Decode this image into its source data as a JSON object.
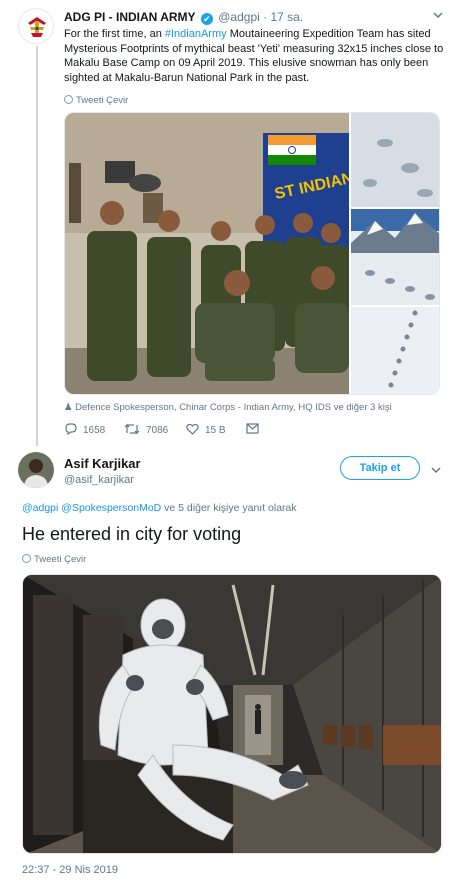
{
  "parent_tweet": {
    "author_name": "ADG PI - INDIAN ARMY",
    "verified_mark": "✔",
    "handle": "@adgpi",
    "separator": "·",
    "time": "17 sa.",
    "text_before": "For the first time, an ",
    "hashtag": "#IndianArmy",
    "text_after": " Moutaineering Expedition Team has sited Mysterious Footprints of mythical beast 'Yeti' measuring 32x15 inches close to Makalu Base Camp on 09 April 2019. This elusive snowman has only been sighted at Makalu-Barun National Park in the past.",
    "translate_label": "Tweeti Çevir",
    "tagged_people": "Defence Spokesperson, Chinar Corps - Indian Army, HQ IDS ve diğer 3 kişi",
    "reply_count": "1658",
    "retweet_count": "7086",
    "like_count": "15 B",
    "icons": [
      "army-emblem-icon",
      "verified-icon",
      "chevron-down-icon",
      "globe-icon",
      "person-tag-icon",
      "reply-icon",
      "retweet-icon",
      "like-icon",
      "message-icon"
    ]
  },
  "reply_tweet": {
    "author_name": "Asif Karjikar",
    "handle": "@asif_karjikar",
    "follow_label": "Takip et",
    "replying_mention_1": "@adgpi",
    "replying_mention_2": "@SpokespersonMoD",
    "replying_suffix": " ve 5 diğer kişiye yanıt olarak",
    "text": "He entered in city for voting",
    "translate_label": "Tweeti Çevir",
    "timestamp": "22:37 - 29 Nis 2019"
  },
  "colors": {
    "link": "#1b95e0",
    "accent": "#1da1f2",
    "muted": "#657786",
    "line": "#ccd6dd",
    "flag_saffron": "#f39c33",
    "flag_green": "#138808",
    "banner_blue": "#1f3f8f",
    "army_uniform": "#3e4a2a"
  }
}
